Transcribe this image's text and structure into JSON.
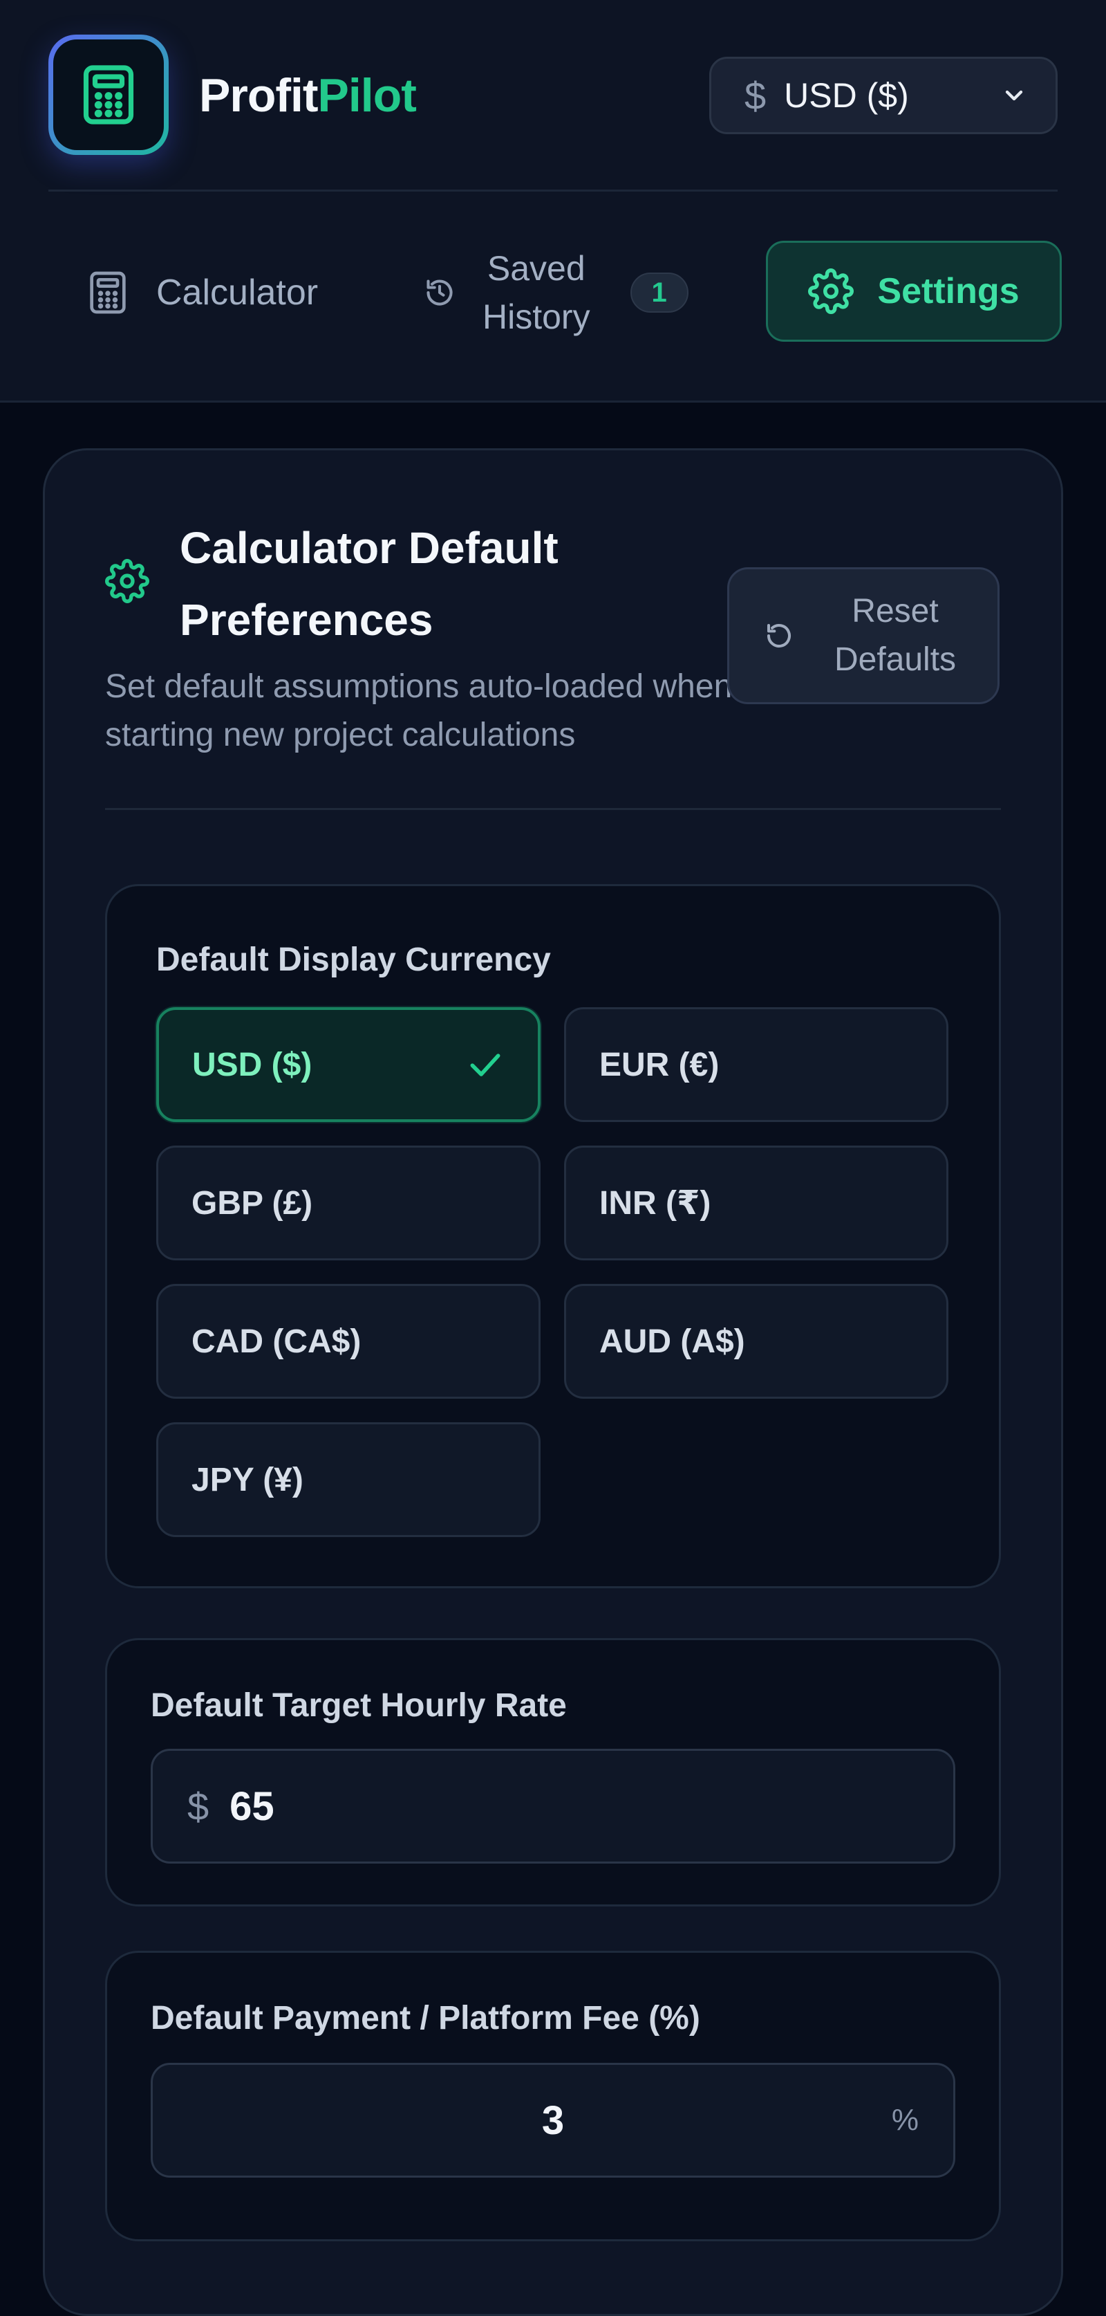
{
  "app": {
    "brand_part1": "Profit",
    "brand_part2": "Pilot",
    "accent_color": "#22c98b"
  },
  "header": {
    "currency_symbol": "$",
    "currency_selected": "USD ($)"
  },
  "nav": {
    "calculator_label": "Calculator",
    "history_label_line1": "Saved",
    "history_label_line2": "History",
    "history_count": "1",
    "settings_label": "Settings",
    "active_tab": "settings"
  },
  "preferences": {
    "title": "Calculator Default Preferences",
    "subtitle": "Set default assumptions auto-loaded when starting new project calculations",
    "reset_label_line1": "Reset",
    "reset_label_line2": "Defaults",
    "currency_section_label": "Default Display Currency",
    "currencies": [
      {
        "label": "USD ($)",
        "selected": true
      },
      {
        "label": "EUR (€)",
        "selected": false
      },
      {
        "label": "GBP (£)",
        "selected": false
      },
      {
        "label": "INR (₹)",
        "selected": false
      },
      {
        "label": "CAD (CA$)",
        "selected": false
      },
      {
        "label": "AUD (A$)",
        "selected": false
      },
      {
        "label": "JPY (¥)",
        "selected": false
      }
    ],
    "hourly_rate_label": "Default Target Hourly Rate",
    "hourly_rate_prefix": "$",
    "hourly_rate_value": "65",
    "fee_label": "Default Payment / Platform Fee (%)",
    "fee_value": "3",
    "fee_suffix": "%"
  }
}
